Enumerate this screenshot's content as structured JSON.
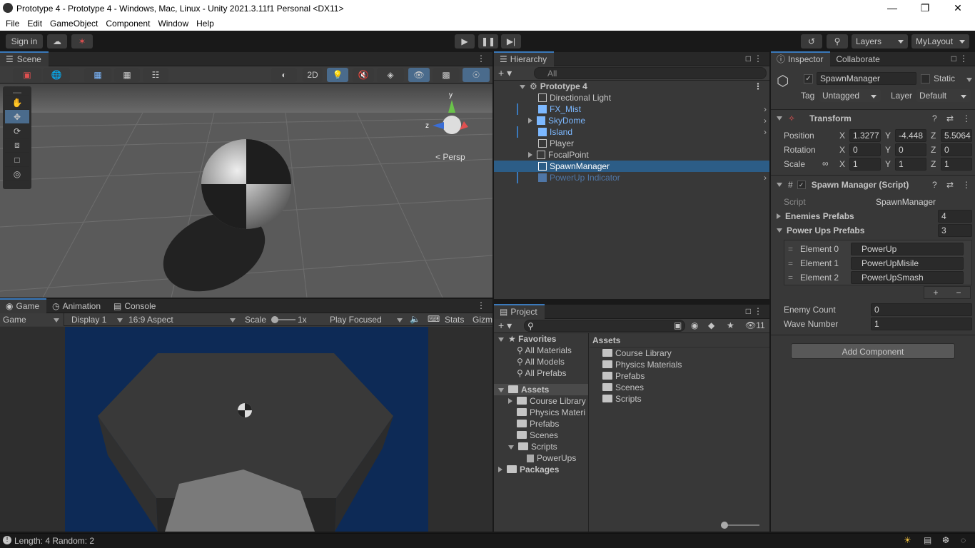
{
  "window": {
    "title": "Prototype 4 - Prototype 4 - Windows, Mac, Linux - Unity 2021.3.11f1 Personal <DX11>"
  },
  "menu": [
    "File",
    "Edit",
    "GameObject",
    "Component",
    "Window",
    "Help"
  ],
  "toolbar": {
    "sign_in": "Sign in",
    "layers": "Layers",
    "layout": "MyLayout"
  },
  "scene": {
    "tab": "Scene",
    "btn_2d": "2D",
    "persp": "Persp",
    "gizmo_y": "y",
    "gizmo_z": "z"
  },
  "game": {
    "tabs": [
      "Game",
      "Animation",
      "Console"
    ],
    "mode": "Game",
    "display": "Display 1",
    "aspect": "16:9 Aspect",
    "scale_label": "Scale",
    "scale_value": "1x",
    "play_focused": "Play Focused",
    "stats": "Stats",
    "gizmos": "Gizm"
  },
  "hierarchy": {
    "tab": "Hierarchy",
    "search_placeholder": "All",
    "scene_name": "Prototype 4",
    "items": [
      {
        "label": "Directional Light"
      },
      {
        "label": "FX_Mist"
      },
      {
        "label": "SkyDome"
      },
      {
        "label": "Island"
      },
      {
        "label": "Player"
      },
      {
        "label": "FocalPoint"
      },
      {
        "label": "SpawnManager"
      },
      {
        "label": "PowerUp Indicator"
      }
    ]
  },
  "project": {
    "tab": "Project",
    "badge": "11",
    "favorites_label": "Favorites",
    "favorites": [
      "All Materials",
      "All Models",
      "All Prefabs"
    ],
    "assets_label": "Assets",
    "assets_tree": [
      "Course Library",
      "Physics Materi",
      "Prefabs",
      "Scenes",
      "Scripts"
    ],
    "script_child": "PowerUps",
    "packages_label": "Packages",
    "breadcrumb": "Assets",
    "folders": [
      "Course Library",
      "Physics Materials",
      "Prefabs",
      "Scenes",
      "Scripts"
    ]
  },
  "inspector": {
    "tabs": [
      "Inspector",
      "Collaborate"
    ],
    "object_name": "SpawnManager",
    "static_label": "Static",
    "tag_label": "Tag",
    "tag_value": "Untagged",
    "layer_label": "Layer",
    "layer_value": "Default",
    "transform": {
      "title": "Transform",
      "position_label": "Position",
      "position": [
        "1.3277",
        "-4.448",
        "5.5064"
      ],
      "rotation_label": "Rotation",
      "rotation": [
        "0",
        "0",
        "0"
      ],
      "scale_label": "Scale",
      "scale": [
        "1",
        "1",
        "1"
      ],
      "axes": [
        "X",
        "Y",
        "Z"
      ]
    },
    "script_component": {
      "title": "Spawn Manager (Script)",
      "script_label": "Script",
      "script_value": "SpawnManager",
      "enemies_label": "Enemies Prefabs",
      "enemies_count": "4",
      "powerups_label": "Power Ups Prefabs",
      "powerups_count": "3",
      "elements": [
        {
          "label": "Element 0",
          "value": "PowerUp"
        },
        {
          "label": "Element 1",
          "value": "PowerUpMisile"
        },
        {
          "label": "Element 2",
          "value": "PowerUpSmash"
        }
      ],
      "enemy_count_label": "Enemy Count",
      "enemy_count": "0",
      "wave_number_label": "Wave Number",
      "wave_number": "1"
    },
    "add_component": "Add Component"
  },
  "status": {
    "text": "Length: 4 Random: 2"
  }
}
